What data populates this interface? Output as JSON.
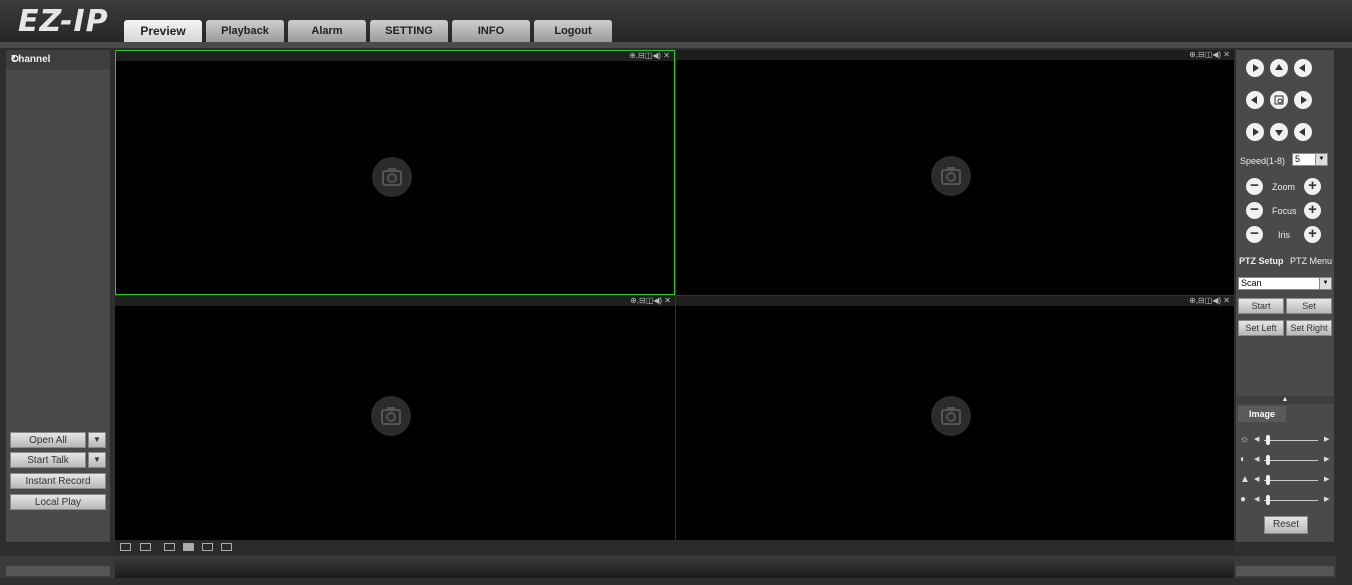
{
  "app": {
    "logo": "EZ-IP"
  },
  "nav": {
    "tabs": [
      {
        "label": "Preview",
        "active": true
      },
      {
        "label": "Playback"
      },
      {
        "label": "Alarm"
      },
      {
        "label": "SETTING"
      },
      {
        "label": "INFO"
      },
      {
        "label": "Logout"
      }
    ]
  },
  "left": {
    "title": "Channel",
    "refresh_icon": "refresh-icon",
    "open_all": "Open All",
    "start_talk": "Start Talk",
    "instant_record": "Instant Record",
    "local_play": "Local Play"
  },
  "tiles": {
    "toolbar_icons": "⊕,⊟◫◀) ✕",
    "placeholder_icon": "camera-icon"
  },
  "ptz": {
    "speed_label": "Speed(1-8)",
    "speed_value": "5",
    "zoom_label": "Zoom",
    "focus_label": "Focus",
    "iris_label": "Iris",
    "tab_setup": "PTZ Setup",
    "tab_menu": "PTZ Menu",
    "mode_value": "Scan",
    "start": "Start",
    "set": "Set",
    "set_left": "Set Left",
    "set_right": "Set Right"
  },
  "image": {
    "tab": "Image",
    "reset": "Reset",
    "sliders": [
      {
        "icon": "brightness-icon",
        "glyph": "☼"
      },
      {
        "icon": "contrast-icon",
        "glyph": "◐"
      },
      {
        "icon": "saturation-icon",
        "glyph": "▲"
      },
      {
        "icon": "hue-icon",
        "glyph": "●"
      }
    ]
  },
  "colors": {
    "selected_border": "#2fc22f",
    "panel": "#4a4a4a"
  }
}
